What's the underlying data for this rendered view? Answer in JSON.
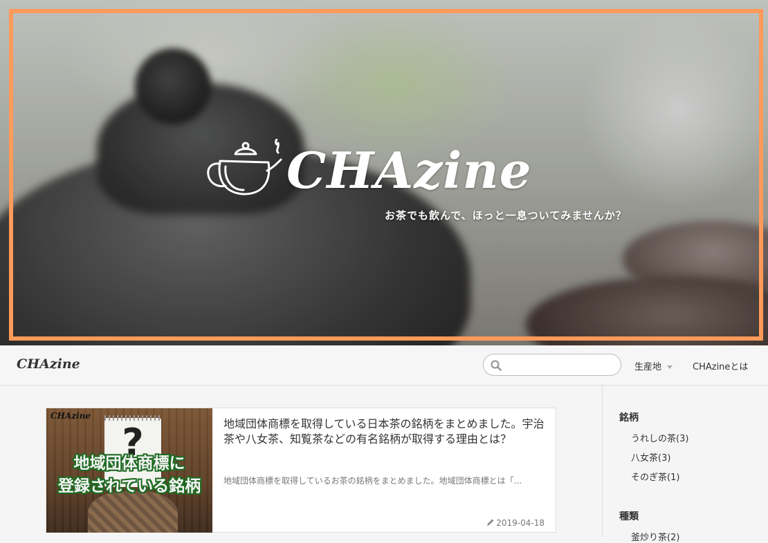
{
  "hero": {
    "logo_text": "CHAzine",
    "tagline": "お茶でも飲んで、ほっと一息ついてみませんか？",
    "frame_color": "#ff9a5a",
    "logo_icon": "teapot-icon"
  },
  "navbar": {
    "brand": "CHAzine",
    "search": {
      "placeholder": "",
      "value": "",
      "icon": "search-icon"
    },
    "menu": [
      {
        "label": "生産地",
        "has_dropdown": true
      },
      {
        "label": "CHAzineとは",
        "has_dropdown": false
      }
    ]
  },
  "posts": [
    {
      "title": "地域団体商標を取得している日本茶の銘柄をまとめました。宇治茶や八女茶、知覧茶などの有名銘柄が取得する理由とは？",
      "excerpt": "地域団体商標を取得しているお茶の銘柄をまとめました。地域団体商標とは「...",
      "date": "2019-04-18",
      "date_icon": "pencil-icon",
      "thumbnail": {
        "brand": "CHAzine",
        "line1": "地域団体商標に",
        "line2": "登録されている銘柄",
        "symbol": "?"
      }
    }
  ],
  "sidebar": {
    "sections": [
      {
        "heading": "銘柄",
        "items": [
          "うれしの茶(3)",
          "八女茶(3)",
          "そのぎ茶(1)"
        ]
      },
      {
        "heading": "種類",
        "items": [
          "釜炒り茶(2)"
        ]
      }
    ]
  }
}
